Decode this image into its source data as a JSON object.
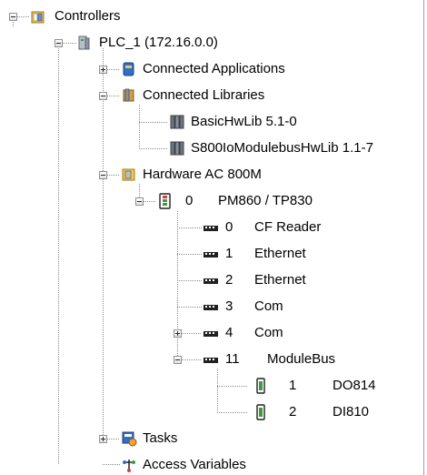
{
  "tree": {
    "root": {
      "label": "Controllers",
      "icon": "controllers-folder-icon",
      "plc": {
        "label": "PLC_1 (172.16.0.0)",
        "icon": "plc-icon",
        "connected_applications": {
          "label": "Connected Applications",
          "icon": "applications-icon"
        },
        "connected_libraries": {
          "label": "Connected Libraries",
          "icon": "libraries-icon",
          "items": [
            {
              "label": "BasicHwLib 5.1-0",
              "icon": "library-book-icon"
            },
            {
              "label": "S800IoModulebusHwLib 1.1-7",
              "icon": "library-book-icon"
            }
          ]
        },
        "hardware": {
          "label": "Hardware AC 800M",
          "icon": "hardware-folder-icon",
          "cpu": {
            "position": "0",
            "label": "PM860 / TP830",
            "icon": "cpu-module-icon",
            "units": [
              {
                "position": "0",
                "label": "CF Reader",
                "icon": "port-connector-icon"
              },
              {
                "position": "1",
                "label": "Ethernet",
                "icon": "port-connector-icon"
              },
              {
                "position": "2",
                "label": "Ethernet",
                "icon": "port-connector-icon"
              },
              {
                "position": "3",
                "label": "Com",
                "icon": "port-connector-icon"
              },
              {
                "position": "4",
                "label": "Com",
                "icon": "port-connector-icon"
              },
              {
                "position": "11",
                "label": "ModuleBus",
                "icon": "port-connector-icon"
              }
            ],
            "modulebus_children": [
              {
                "position": "1",
                "label": "DO814",
                "icon": "io-module-icon"
              },
              {
                "position": "2",
                "label": "DI810",
                "icon": "io-module-icon"
              }
            ]
          }
        },
        "tasks": {
          "label": "Tasks",
          "icon": "tasks-icon"
        },
        "access_variables": {
          "label": "Access Variables",
          "icon": "access-variables-icon"
        }
      }
    }
  },
  "colors": {
    "tree_line": "#8c8c8c",
    "folder_yellow": "#f2c94a",
    "module_green": "#3f9a3f",
    "module_red": "#d04040",
    "library_gray": "#8a8f98",
    "app_blue": "#2f6fc8"
  }
}
